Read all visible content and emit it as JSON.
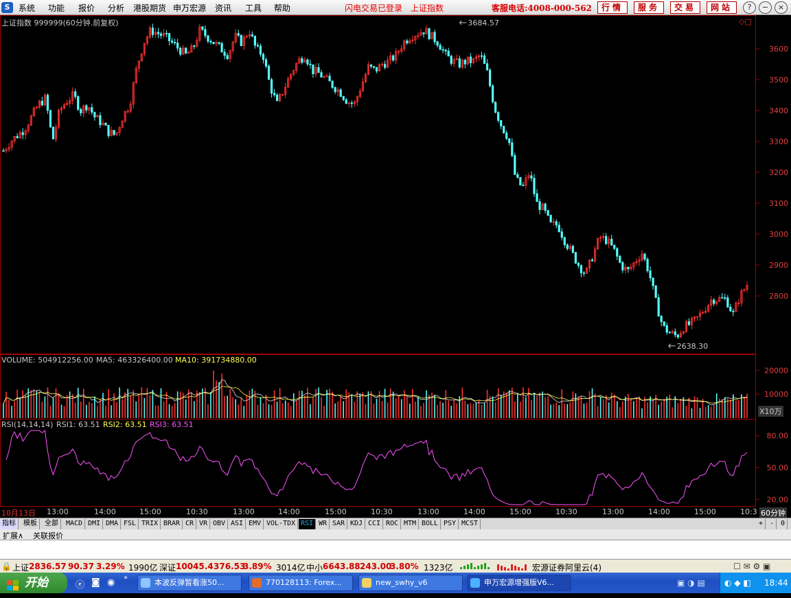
{
  "app": {
    "menu": [
      "系统",
      "功能",
      "报价",
      "分析",
      "港股期货",
      "申万宏源",
      "资讯",
      "工具",
      "帮助"
    ],
    "status_links": [
      "闪电交易已登录",
      "上证指数"
    ],
    "hotline": "客服电话:4008-000-562",
    "top_buttons": [
      "行情",
      "服务",
      "交易",
      "网站"
    ],
    "window_controls": [
      "?",
      "−",
      "□",
      "×"
    ]
  },
  "main_panel": {
    "title": "上证指数 999999(60分钟.前复权)",
    "high_label": "3684.57",
    "low_label": "2638.30",
    "price_ticks": [
      "3600",
      "3500",
      "3400",
      "3300",
      "3200",
      "3100",
      "3000",
      "2900",
      "2800"
    ],
    "up_color": "#ff3232",
    "down_color": "#54ffff"
  },
  "volume_panel": {
    "vol_label": "VOLUME: 504912256.00",
    "ma5_label": "MA5: 463326400.00",
    "ma10_label": "MA10: 391734880.00",
    "ticks": [
      "20000",
      "10000"
    ],
    "unit": "X10万"
  },
  "rsi_panel": {
    "title": "RSI(14,14,14)",
    "rsi1": "RSI1: 63.51",
    "rsi2": "RSI2: 63.51",
    "rsi3": "RSI3: 63.51",
    "ticks": [
      "80.00",
      "50.00",
      "20.00"
    ]
  },
  "timebar": {
    "labels": [
      "10月13日",
      "13:00",
      "14:00",
      "15:00",
      "10:30",
      "13:00",
      "14:00",
      "15:00",
      "10:30",
      "13:00",
      "14:00",
      "15:00",
      "10:30",
      "13:00",
      "14:00",
      "15:00",
      "10:3"
    ],
    "period": "60分钟"
  },
  "indicator_tabs": [
    "指标",
    "模板",
    "全部",
    "MACD",
    "DMI",
    "DMA",
    "FSL",
    "TRIX",
    "BRAR",
    "CR",
    "VR",
    "OBV",
    "ASI",
    "EMV",
    "VOL-TDX",
    "RSI",
    "WR",
    "SAR",
    "KDJ",
    "CCI",
    "ROC",
    "MTM",
    "BOLL",
    "PSY",
    "MCST"
  ],
  "active_tab": "RSI",
  "tab_controls": [
    "+",
    "-",
    "0"
  ],
  "ext_bar": [
    "扩展∧",
    "关联报价"
  ],
  "status_bar": {
    "sh": {
      "name": "上证",
      "price": "2836.57",
      "change": "90.37",
      "pct": "3.29%",
      "amount": "1990亿"
    },
    "sz": {
      "name": "深证",
      "price": "10045.4",
      "change": "376.53",
      "pct": "3.89%",
      "amount": "3014亿"
    },
    "zx": {
      "name": "中小",
      "price": "6643.88",
      "change": "243.00",
      "pct": "3.80%",
      "amount": "1323亿"
    },
    "broker": "宏源证券阿里云(4)"
  },
  "taskbar": {
    "start": "开始",
    "tasks": [
      "本波反弹暂看涨50...",
      "770128113: Forex...",
      "new_swhy_v6",
      "申万宏源增强版V6..."
    ],
    "clock": "18:44"
  },
  "chart_data": {
    "type": "candlestick",
    "title": "上证指数 999999(60分钟.前复权)",
    "period": "60分钟",
    "y_range": [
      2620,
      3700
    ],
    "high": 3684.57,
    "low": 2638.3,
    "close_series_approx": [
      3270,
      3300,
      3320,
      3340,
      3380,
      3420,
      3440,
      3300,
      3400,
      3430,
      3450,
      3400,
      3420,
      3380,
      3360,
      3330,
      3320,
      3380,
      3420,
      3540,
      3620,
      3660,
      3650,
      3640,
      3620,
      3600,
      3580,
      3600,
      3660,
      3640,
      3620,
      3600,
      3580,
      3640,
      3620,
      3660,
      3600,
      3580,
      3480,
      3420,
      3470,
      3520,
      3560,
      3580,
      3530,
      3520,
      3500,
      3480,
      3460,
      3430,
      3420,
      3480,
      3540,
      3530,
      3550,
      3560,
      3580,
      3620,
      3640,
      3650,
      3660,
      3640,
      3620,
      3580,
      3560,
      3550,
      3560,
      3560,
      3580,
      3520,
      3410,
      3350,
      3310,
      3180,
      3150,
      3200,
      3100,
      3080,
      3030,
      3030,
      2980,
      2940,
      2900,
      2870,
      2930,
      2990,
      2980,
      2950,
      2900,
      2880,
      2910,
      2940,
      2880,
      2780,
      2700,
      2680,
      2670,
      2700,
      2710,
      2730,
      2760,
      2790,
      2790,
      2790,
      2740,
      2800,
      2836
    ],
    "volume_ticks_x10w": [
      20000,
      10000
    ],
    "rsi_last": 63.51,
    "rsi_range": [
      20,
      80
    ]
  }
}
